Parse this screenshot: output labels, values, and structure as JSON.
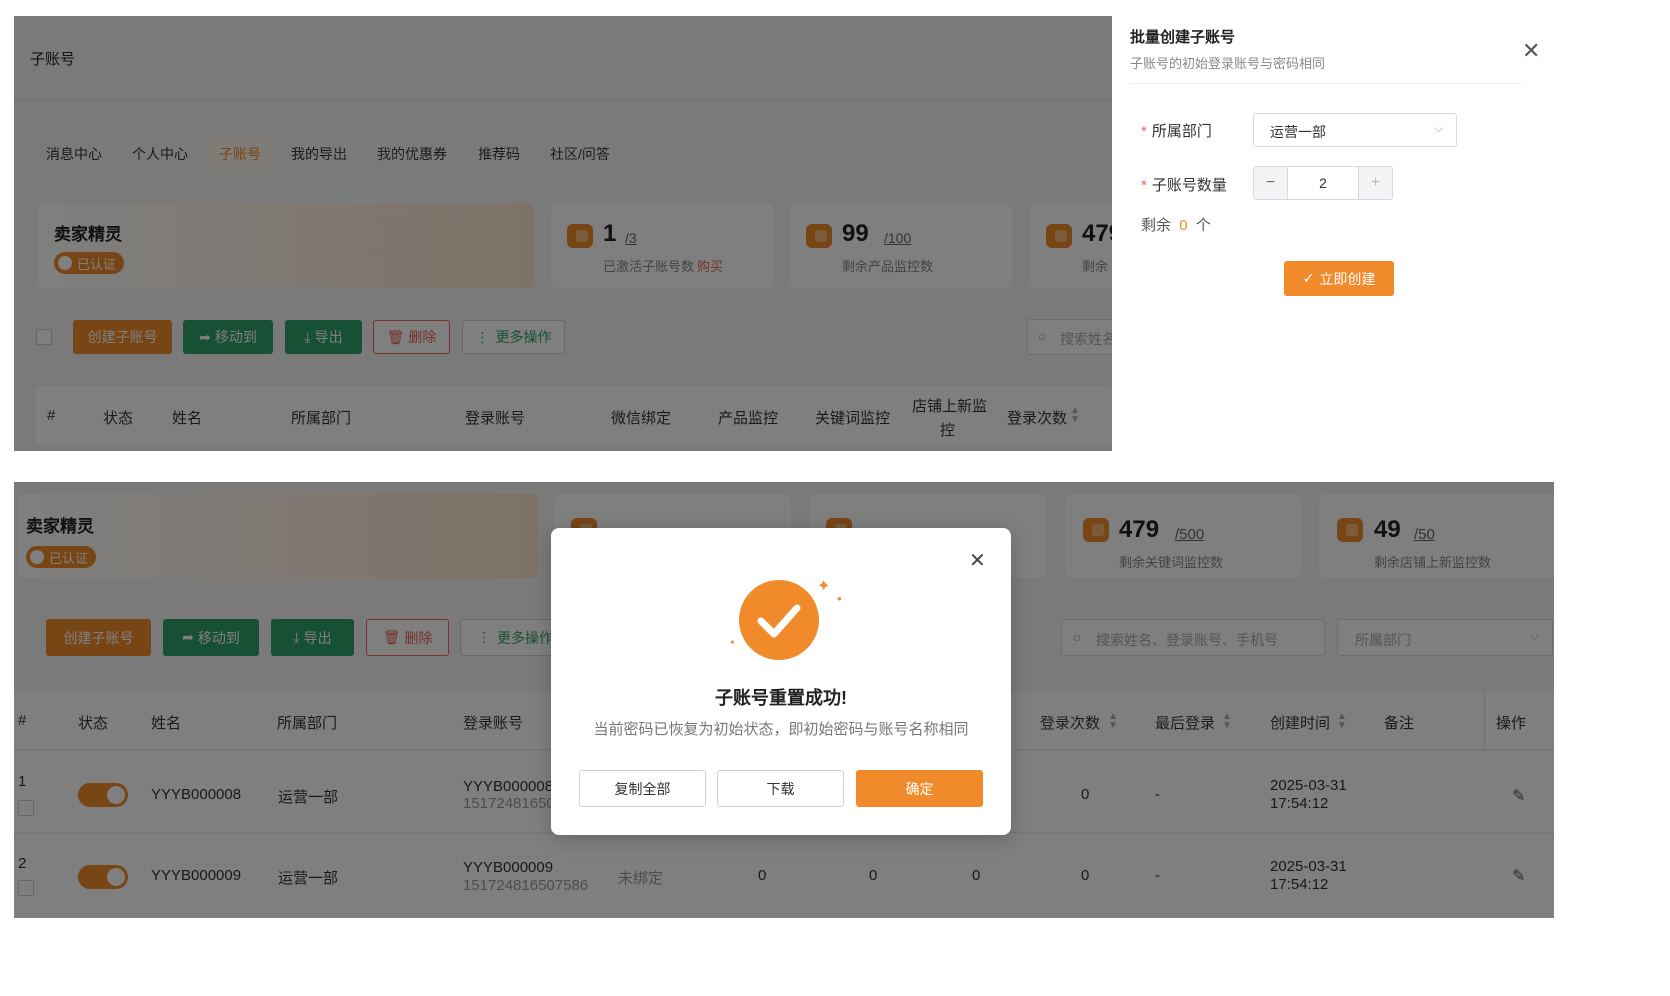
{
  "top": {
    "page_title": "子账号",
    "tabs": [
      "消息中心",
      "个人中心",
      "子账号",
      "我的导出",
      "我的优惠券",
      "推荐码",
      "社区/问答"
    ],
    "company": "卖家精灵",
    "verified": "已认证",
    "stats": [
      {
        "value": "1",
        "total": "/3",
        "label": "已激活子账号数",
        "link": "购买"
      },
      {
        "value": "99",
        "total": "/100",
        "label": "剩余产品监控数"
      },
      {
        "value": "479",
        "total": "",
        "label": "剩余"
      }
    ],
    "toolbar": {
      "create": "创建子账号",
      "move": "移动到",
      "export": "导出",
      "delete": "删除",
      "more": "更多操作",
      "search_placeholder": "搜索姓名"
    },
    "columns": [
      "#",
      "状态",
      "姓名",
      "所属部门",
      "登录账号",
      "微信绑定",
      "产品监控",
      "关键词监控",
      "店铺上新监",
      "控",
      "登录次数"
    ]
  },
  "drawer": {
    "title": "批量创建子账号",
    "subtitle": "子账号的初始登录账号与密码相同",
    "dept_label": "所属部门",
    "dept_value": "运营一部",
    "count_label": "子账号数量",
    "count_value": "2",
    "remaining_prefix": "剩余",
    "remaining_value": "0",
    "remaining_suffix": "个",
    "create_button": "立即创建"
  },
  "bottom": {
    "company": "卖家精灵",
    "verified": "已认证",
    "stats": [
      {
        "value": "479",
        "total": "/500",
        "label": "剩余关键词监控数"
      },
      {
        "value": "49",
        "total": "/50",
        "label": "剩余店铺上新监控数"
      }
    ],
    "toolbar": {
      "create": "创建子账号",
      "move": "移动到",
      "export": "导出",
      "delete": "删除",
      "more": "更多操作",
      "search_placeholder": "搜索姓名、登录账号、手机号",
      "dept_placeholder": "所属部门"
    },
    "columns": [
      "#",
      "状态",
      "姓名",
      "所属部门",
      "登录账号",
      "登录次数",
      "最后登录",
      "创建时间",
      "备注",
      "操作"
    ],
    "rows": [
      {
        "index": "1",
        "name": "YYYB000008",
        "dept": "运营一部",
        "account": "YYYB000008",
        "phone": "15172481650",
        "wechat": "",
        "product": "",
        "keyword": "",
        "store": "",
        "logins": "0",
        "last": "-",
        "created_date": "2025-03-31",
        "created_time": "17:54:12"
      },
      {
        "index": "2",
        "name": "YYYB000009",
        "dept": "运营一部",
        "account": "YYYB000009",
        "phone": "151724816507586",
        "wechat": "未绑定",
        "product": "0",
        "keyword": "0",
        "store": "0",
        "logins": "0",
        "last": "-",
        "created_date": "2025-03-31",
        "created_time": "17:54:12"
      }
    ]
  },
  "modal": {
    "title": "子账号重置成功!",
    "message": "当前密码已恢复为初始状态，即初始密码与账号名称相同",
    "copy_all": "复制全部",
    "download": "下载",
    "confirm": "确定"
  },
  "colors": {
    "accent": "#f08a2b",
    "green": "#2fa06a",
    "red": "#e8635a"
  }
}
